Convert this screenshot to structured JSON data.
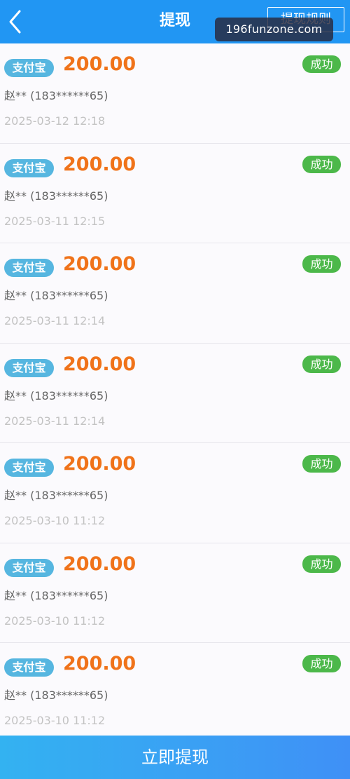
{
  "header": {
    "title": "提现",
    "rules_label": "提现规则",
    "back_icon": "chevron-left-icon"
  },
  "watermark": "196funzone.com",
  "records": [
    {
      "channel": "支付宝",
      "amount": "200.00",
      "status": "成功",
      "account": "赵** (183******65)",
      "time": "2025-03-12 12:18"
    },
    {
      "channel": "支付宝",
      "amount": "200.00",
      "status": "成功",
      "account": "赵** (183******65)",
      "time": "2025-03-11 12:15"
    },
    {
      "channel": "支付宝",
      "amount": "200.00",
      "status": "成功",
      "account": "赵** (183******65)",
      "time": "2025-03-11 12:14"
    },
    {
      "channel": "支付宝",
      "amount": "200.00",
      "status": "成功",
      "account": "赵** (183******65)",
      "time": "2025-03-11 12:14"
    },
    {
      "channel": "支付宝",
      "amount": "200.00",
      "status": "成功",
      "account": "赵** (183******65)",
      "time": "2025-03-10 11:12"
    },
    {
      "channel": "支付宝",
      "amount": "200.00",
      "status": "成功",
      "account": "赵** (183******65)",
      "time": "2025-03-10 11:12"
    },
    {
      "channel": "支付宝",
      "amount": "200.00",
      "status": "成功",
      "account": "赵** (183******65)",
      "time": "2025-03-10 11:12"
    }
  ],
  "footer": {
    "withdraw_label": "立即提现"
  },
  "colors": {
    "header_bg": "#2196f3",
    "amount": "#f0731a",
    "status_success": "#4cb84a",
    "channel_badge": "#56b6e0"
  }
}
